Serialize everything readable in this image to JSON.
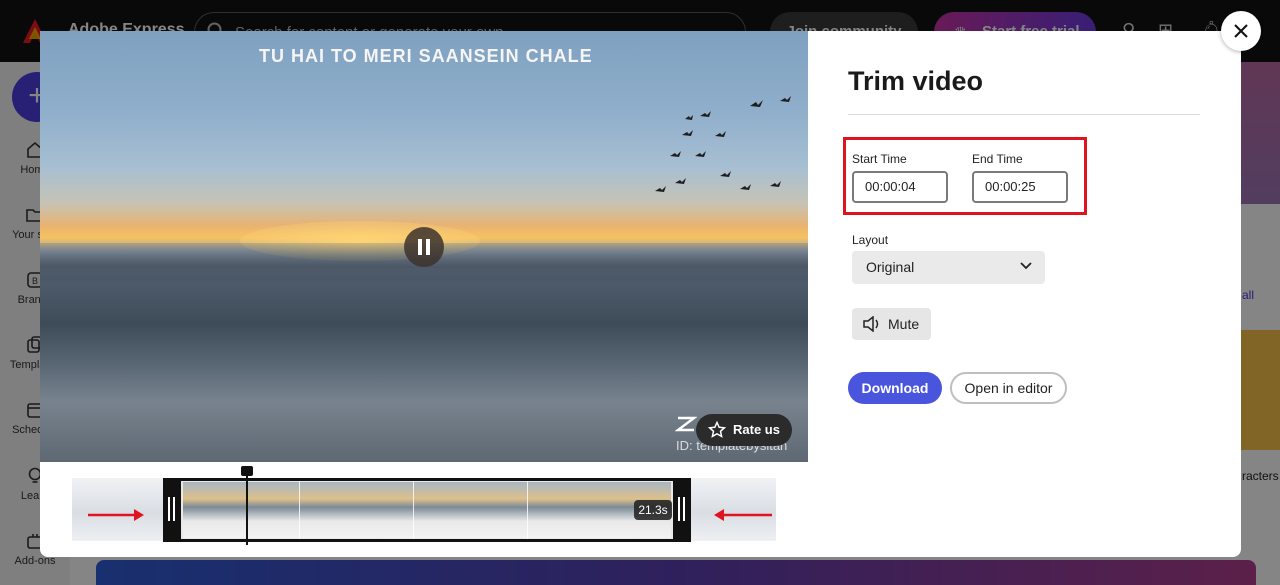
{
  "app": {
    "title": "Adobe Express",
    "search_placeholder": "Search for content or generate your own",
    "join_label": "Join community",
    "trial_label": "Start free trial",
    "brand_color": "#ed1c24",
    "accent_color": "#4b3fdf"
  },
  "sidebar": {
    "create_label": "+",
    "items": [
      {
        "label": "Home",
        "icon": "home-icon"
      },
      {
        "label": "Your stuff",
        "icon": "folder-icon"
      },
      {
        "label": "Brands",
        "icon": "brand-icon"
      },
      {
        "label": "Templates",
        "icon": "templates-icon"
      },
      {
        "label": "Schedule",
        "icon": "calendar-icon"
      },
      {
        "label": "Learn",
        "icon": "lightbulb-icon"
      },
      {
        "label": "Add-ons",
        "icon": "addons-icon"
      }
    ]
  },
  "background": {
    "view_all": "all",
    "characters": "racters"
  },
  "video": {
    "caption": "TU HAI TO MERI SAANSEIN CHALE",
    "watermark": "ID: templatebysitah",
    "rate_label": "Rate us",
    "state": "playing"
  },
  "timeline": {
    "duration": "21.3s"
  },
  "trim": {
    "title": "Trim video",
    "start_label": "Start Time",
    "start_value": "00:00:04",
    "end_label": "End Time",
    "end_value": "00:00:25",
    "layout_label": "Layout",
    "layout_value": "Original",
    "mute_label": "Mute",
    "download_label": "Download",
    "editor_label": "Open in editor",
    "highlight_color": "#e0141e",
    "download_color": "#4a55de"
  }
}
